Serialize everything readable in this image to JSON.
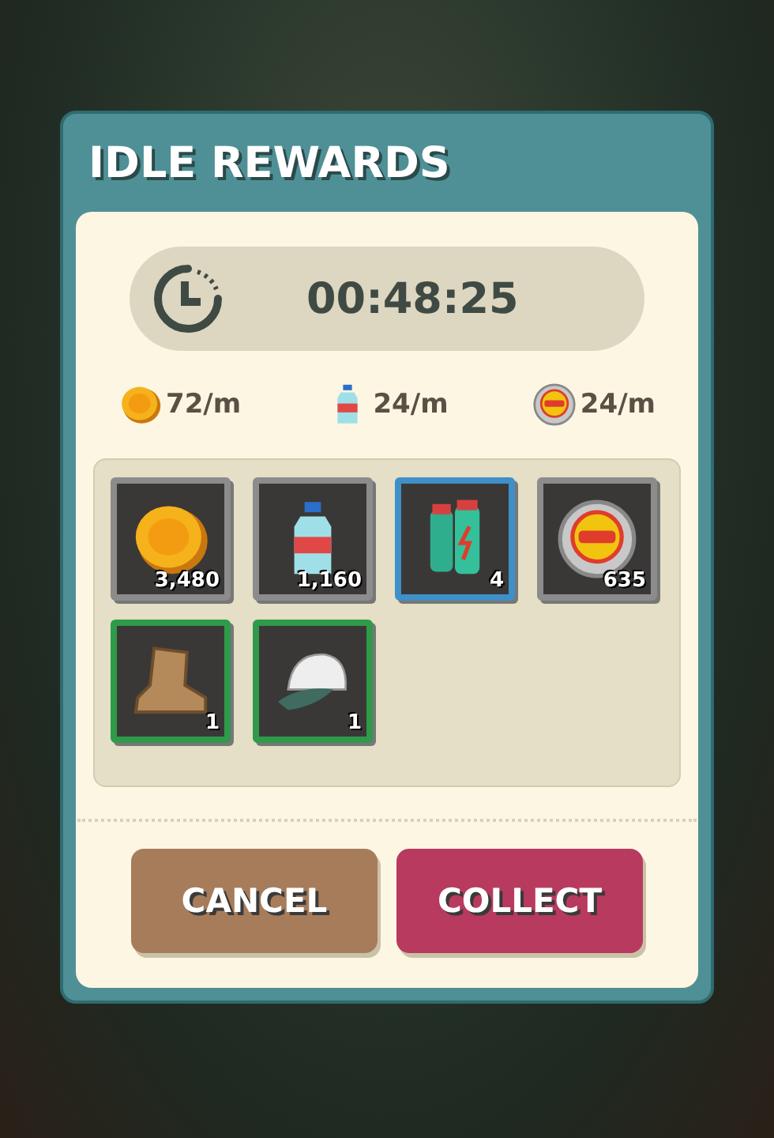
{
  "dialog": {
    "title": "IDLE REWARDS"
  },
  "timer": {
    "value": "00:48:25"
  },
  "rates": [
    {
      "kind": "coin",
      "text": "72/m"
    },
    {
      "kind": "bottle",
      "text": "24/m"
    },
    {
      "kind": "exp-token",
      "text": "24/m"
    }
  ],
  "items": [
    {
      "kind": "coin",
      "count": "3,480",
      "color": "#8c8c8c"
    },
    {
      "kind": "bottle",
      "count": "1,160",
      "color": "#8c8c8c"
    },
    {
      "kind": "drinks",
      "count": "4",
      "color": "#3f8fc8"
    },
    {
      "kind": "exp-token",
      "count": "635",
      "color": "#8c8c8c"
    },
    {
      "kind": "boot",
      "count": "1",
      "color": "#2f9a4a"
    },
    {
      "kind": "cap",
      "count": "1",
      "color": "#2f9a4a"
    }
  ],
  "buttons": [
    {
      "kind": "cancel",
      "label": "CANCEL"
    },
    {
      "kind": "collect",
      "label": "COLLECT"
    }
  ]
}
